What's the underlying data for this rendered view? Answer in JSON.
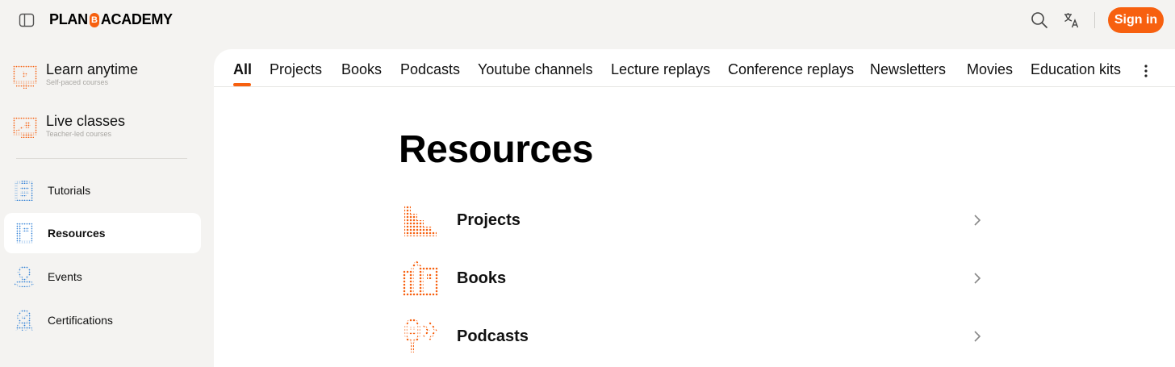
{
  "header": {
    "logo_left": "PLAN",
    "logo_mark": "B",
    "logo_right": "ACADEMY",
    "signin_label": "Sign in",
    "brand_color": "#f7600f",
    "icons": [
      "sidebar-toggle-icon",
      "search-icon",
      "translate-icon"
    ]
  },
  "sidebar": {
    "primary": [
      {
        "title": "Learn anytime",
        "subtitle": "Self-paced courses",
        "icon": "video-icon"
      },
      {
        "title": "Live classes",
        "subtitle": "Teacher-led courses",
        "icon": "teacher-icon"
      }
    ],
    "items": [
      {
        "label": "Tutorials",
        "icon": "clipboard-icon"
      },
      {
        "label": "Resources",
        "icon": "book-icon",
        "active": true
      },
      {
        "label": "Events",
        "icon": "location-pin-icon"
      },
      {
        "label": "Certifications",
        "icon": "badge-icon"
      }
    ]
  },
  "tabs": [
    "All",
    "Projects",
    "Books",
    "Podcasts",
    "Youtube channels",
    "Lecture replays",
    "Conference replays",
    "Newsletters",
    "Movies",
    "Education kits"
  ],
  "active_tab": "All",
  "main": {
    "title": "Resources",
    "rows": [
      {
        "label": "Projects",
        "icon": "projects-icon"
      },
      {
        "label": "Books",
        "icon": "books-icon"
      },
      {
        "label": "Podcasts",
        "icon": "microphone-icon"
      }
    ]
  }
}
